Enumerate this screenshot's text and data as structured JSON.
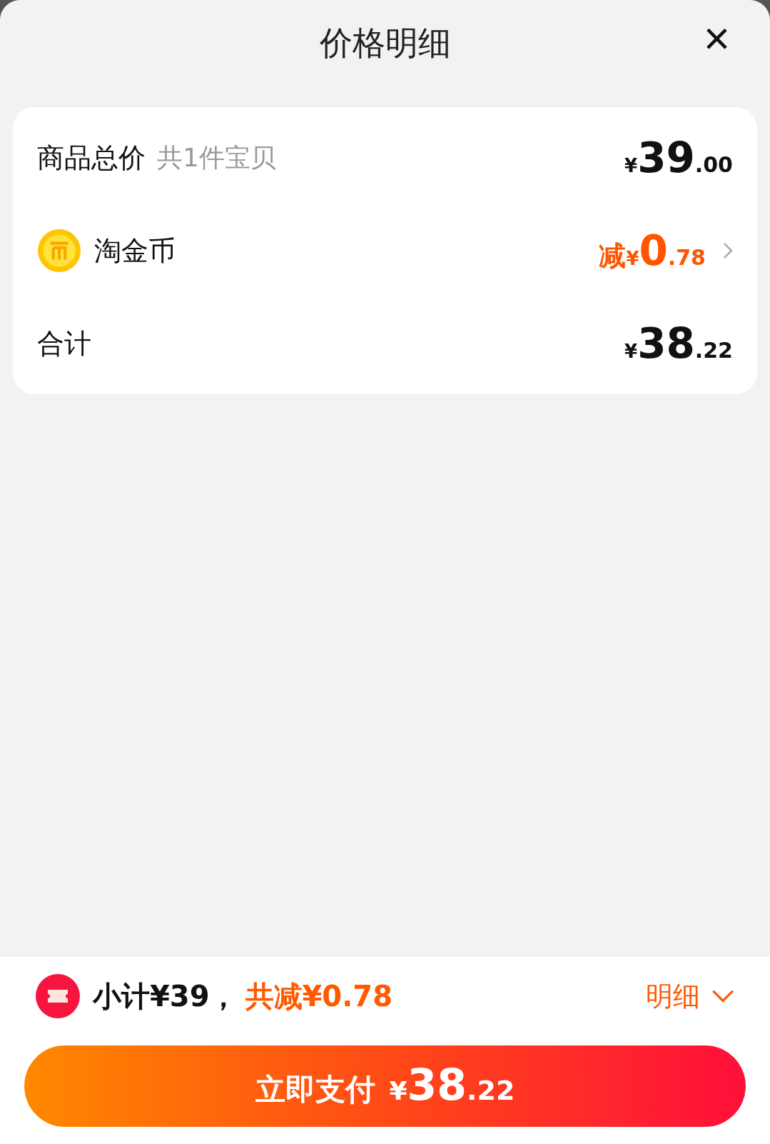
{
  "sheet": {
    "title": "价格明细",
    "close": "×"
  },
  "rows": [
    {
      "kind": "total",
      "label": "商品总价",
      "note": "共1件宝贝",
      "price": {
        "currency": "¥",
        "integer": "39",
        "decimal": ".00"
      }
    },
    {
      "kind": "coin",
      "label": "淘金币",
      "prefix": "减",
      "price": {
        "currency": "¥",
        "integer": "0",
        "decimal": ".78"
      }
    },
    {
      "kind": "sum",
      "label": "合计",
      "price": {
        "currency": "¥",
        "integer": "38",
        "decimal": ".22"
      }
    }
  ],
  "footer": {
    "subtotal": "小计¥39，",
    "discount": "共减¥0.78",
    "details": "明细"
  },
  "pay_button": {
    "label": "立即支付",
    "price": {
      "currency": "¥",
      "integer": "38",
      "decimal": ".22"
    }
  }
}
